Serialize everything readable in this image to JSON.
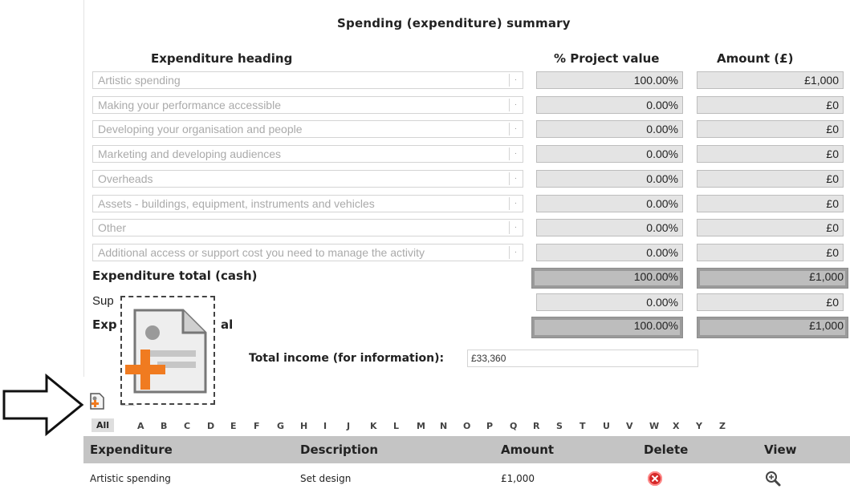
{
  "title": "Spending (expenditure) summary",
  "columns": {
    "heading": "Expenditure heading",
    "percent": "% Project value",
    "amount": "Amount (£)"
  },
  "rows": [
    {
      "heading": "Artistic spending",
      "percent": "100.00%",
      "amount": "£1,000"
    },
    {
      "heading": "Making your performance accessible",
      "percent": "0.00%",
      "amount": "£0"
    },
    {
      "heading": "Developing your organisation and people",
      "percent": "0.00%",
      "amount": "£0"
    },
    {
      "heading": "Marketing and developing audiences",
      "percent": "0.00%",
      "amount": "£0"
    },
    {
      "heading": "Overheads",
      "percent": "0.00%",
      "amount": "£0"
    },
    {
      "heading": "Assets - buildings, equipment, instruments and vehicles",
      "percent": "0.00%",
      "amount": "£0"
    },
    {
      "heading": "Other",
      "percent": "0.00%",
      "amount": "£0"
    },
    {
      "heading": "Additional access or support cost you need to manage the activity",
      "percent": "0.00%",
      "amount": "£0"
    }
  ],
  "totals": {
    "cash": {
      "label": "Expenditure total (cash)",
      "percent": "100.00%",
      "amount": "£1,000"
    },
    "support": {
      "label": "Sup",
      "percent": "0.00%",
      "amount": "£0"
    },
    "total": {
      "label_left": "Exp",
      "label_right": "al",
      "percent": "100.00%",
      "amount": "£1,000"
    }
  },
  "income": {
    "label": "Total income (for information):",
    "value": "£33,360"
  },
  "icons": {
    "overlay": "add-document-icon",
    "arrow": "arrow-right-icon",
    "add": "add-item-icon",
    "remove": "remove-item-icon",
    "delete": "delete-icon",
    "view": "magnifier-icon"
  },
  "alphabet": [
    "All",
    "A",
    "B",
    "C",
    "D",
    "E",
    "F",
    "G",
    "H",
    "I",
    "J",
    "K",
    "L",
    "M",
    "N",
    "O",
    "P",
    "Q",
    "R",
    "S",
    "T",
    "U",
    "V",
    "W",
    "X",
    "Y",
    "Z"
  ],
  "table": {
    "headers": [
      "Expenditure",
      "Description",
      "Amount",
      "Delete",
      "View"
    ],
    "rows": [
      {
        "expenditure": "Artistic spending",
        "description": "Set design",
        "amount": "£1,000"
      }
    ]
  },
  "colors": {
    "delete": "#d62828",
    "accent": "#f07b20"
  }
}
